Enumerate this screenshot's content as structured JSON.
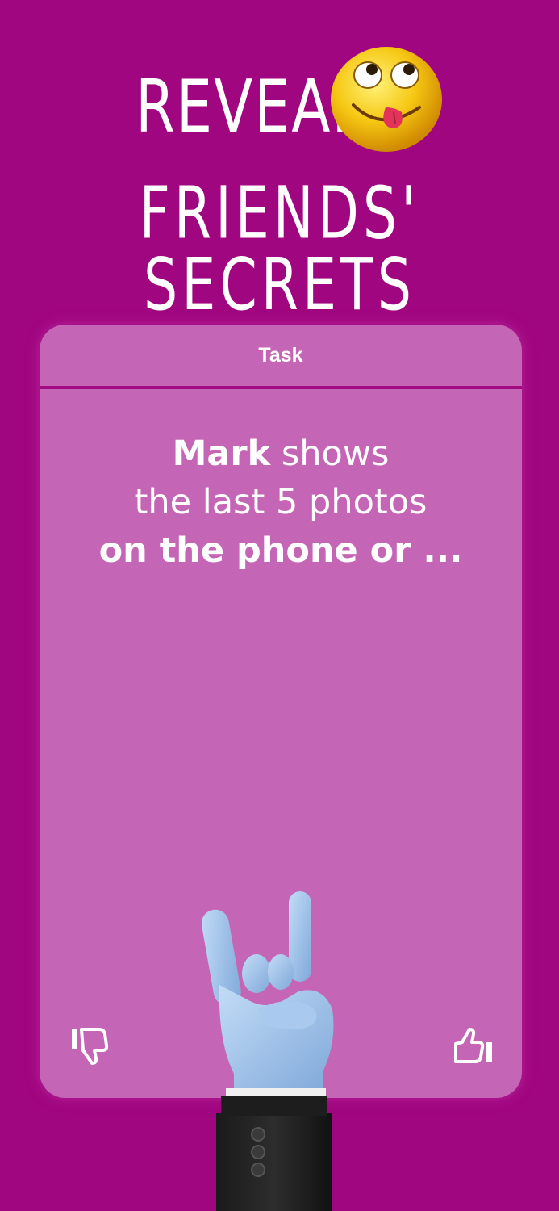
{
  "headline": {
    "line1": "Reveal",
    "line2": "Friends' secrets"
  },
  "emoji": "yum-face-emoji",
  "card": {
    "header": "Task",
    "name": "Mark",
    "line1_rest": " shows",
    "line2": "the last 5 photos",
    "line3": "on the phone or ...",
    "dislike_icon": "thumbs-down-icon",
    "like_icon": "thumbs-up-icon"
  },
  "colors": {
    "background": "#a0067f",
    "card": "#c565b5",
    "divider": "#a20a82",
    "text": "#ffffff"
  }
}
